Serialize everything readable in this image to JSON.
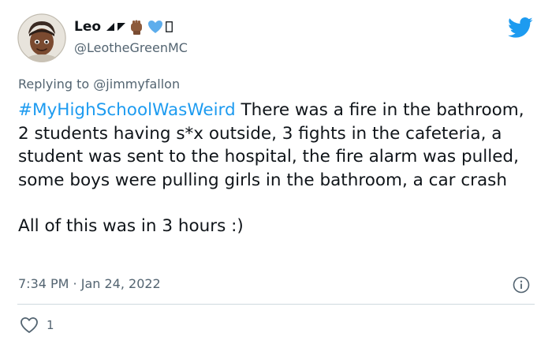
{
  "author": {
    "display_name": "Leo",
    "handle": "@LeotheGreenMC",
    "avatar_icon": "cartoon-avatar"
  },
  "reply": {
    "prefix": "Replying to",
    "mention": "@jimmyfallon"
  },
  "tweet": {
    "hashtag": "#MyHighSchoolWasWeird",
    "body": " There was a fire in the bathroom, 2 students having s*x outside, 3 fights in the cafeteria, a student was sent to the hospital, the fire alarm was pulled, some boys were pulling girls in the bathroom, a car crash",
    "second_paragraph": "All of this was in 3 hours :)"
  },
  "meta": {
    "timestamp": "7:34 PM · Jan 24, 2022"
  },
  "actions": {
    "like_count": "1"
  },
  "colors": {
    "twitter_blue": "#1d9bf0",
    "secondary_text": "#536471",
    "primary_text": "#0f1419"
  }
}
